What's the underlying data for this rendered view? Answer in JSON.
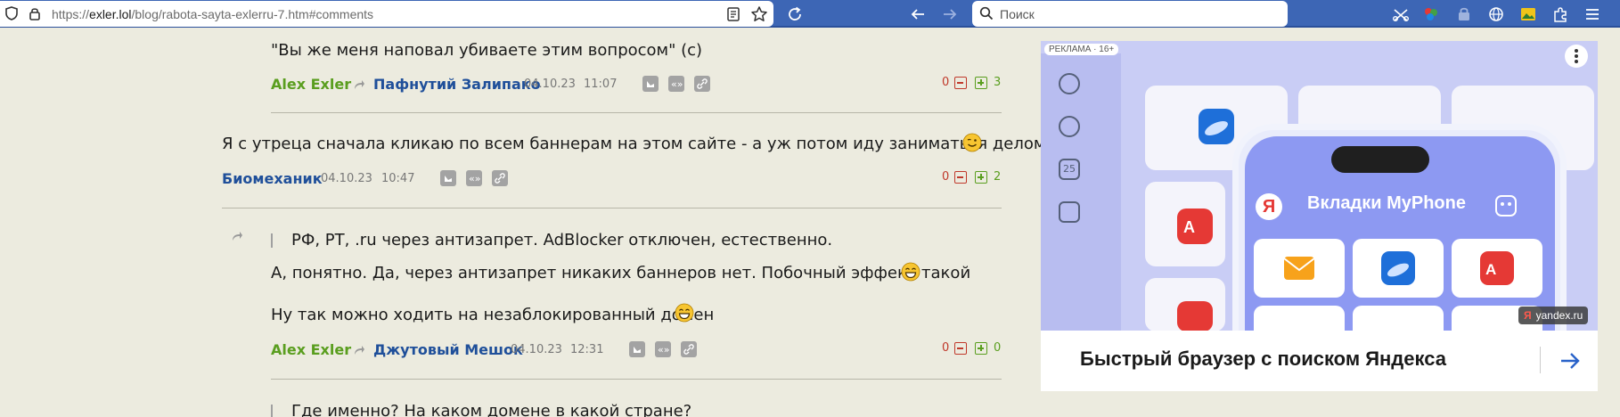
{
  "browser": {
    "url_prefix": "https://",
    "url_host": "exler.lol",
    "url_path": "/blog/rabota-sayta-exlerru-7.htm#comments",
    "search_placeholder": "Поиск"
  },
  "comments": [
    {
      "text": "\"Вы же меня наповал убиваете этим вопросом\" (с)",
      "author": "Alex Exler",
      "reply_to": "Пафнутий Залипако",
      "date": "04.10.23",
      "time": "11:07",
      "votes_down": "0",
      "votes_up": "3"
    },
    {
      "text": "Я с утреца сначала кликаю по всем баннерам на этом сайте - а уж потом иду заниматься делом",
      "author": "Биомеханик",
      "date": "04.10.23",
      "time": "10:47",
      "votes_down": "0",
      "votes_up": "2"
    },
    {
      "quote": "РФ, РТ, .ru через антизапрет. AdBlocker отключен, естественно.",
      "text1": "А, понятно. Да, через антизапрет никаких баннеров нет. Побочный эффект такой",
      "text2": "Ну так можно ходить на незаблокированный домен",
      "author": "Alex Exler",
      "reply_to": "Джутовый Мешок",
      "date": "04.10.23",
      "time": "12:31",
      "votes_down": "0",
      "votes_up": "0"
    },
    {
      "quote": "Где именно? На каком домене в какой стране?"
    }
  ],
  "ad": {
    "label": "РЕКЛАМА · 16+",
    "phone_title": "Вкладки MyPhone",
    "headline": "Быстрый браузер с поиском Яндекса",
    "badge": "yandex.ru",
    "badge_logo": "Я",
    "date_tile": "25"
  }
}
